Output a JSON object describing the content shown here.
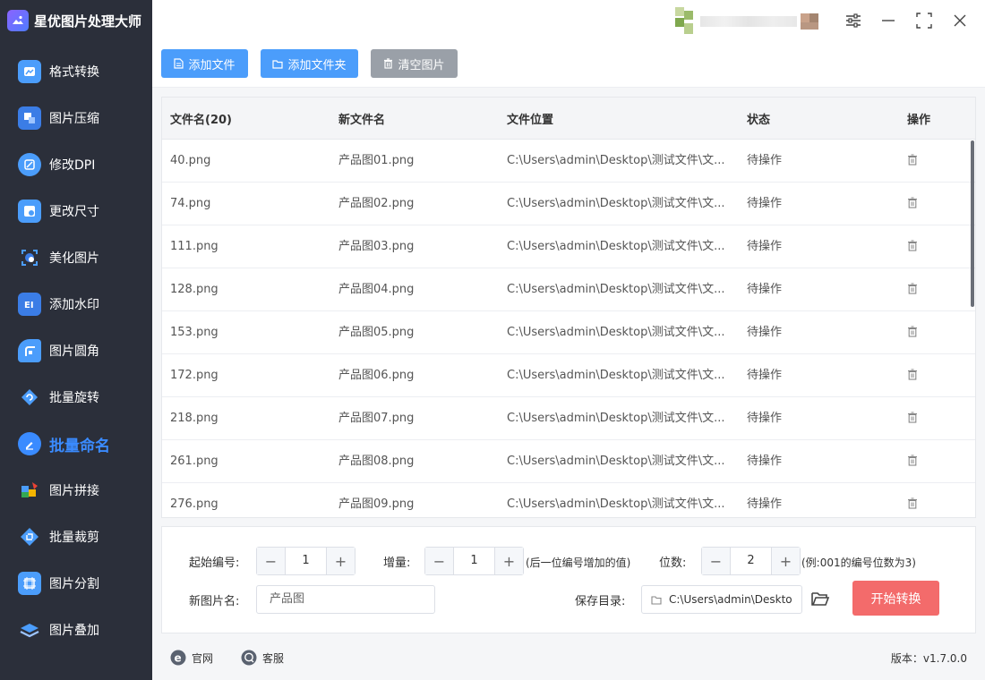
{
  "app": {
    "title": "星优图片处理大师"
  },
  "sidebar": {
    "items": [
      {
        "label": "格式转换",
        "icon": "image-convert-icon",
        "color": "#4b9dfb"
      },
      {
        "label": "图片压缩",
        "icon": "image-compress-icon",
        "color": "#4b9dfb"
      },
      {
        "label": "修改DPI",
        "icon": "dpi-icon",
        "color": "#4b9dfb"
      },
      {
        "label": "更改尺寸",
        "icon": "resize-icon",
        "color": "#4b9dfb"
      },
      {
        "label": "美化图片",
        "icon": "beautify-icon",
        "color": "#4b9dfb"
      },
      {
        "label": "添加水印",
        "icon": "watermark-icon",
        "color": "#4b9dfb"
      },
      {
        "label": "图片圆角",
        "icon": "round-corner-icon",
        "color": "#4b9dfb"
      },
      {
        "label": "批量旋转",
        "icon": "rotate-icon",
        "color": "#4b9dfb"
      },
      {
        "label": "批量命名",
        "icon": "rename-icon",
        "color": "#3a8bff",
        "active": true
      },
      {
        "label": "图片拼接",
        "icon": "stitch-icon",
        "color": "#4b9dfb"
      },
      {
        "label": "批量裁剪",
        "icon": "crop-icon",
        "color": "#4b9dfb"
      },
      {
        "label": "图片分割",
        "icon": "split-icon",
        "color": "#4b9dfb"
      },
      {
        "label": "图片叠加",
        "icon": "overlay-icon",
        "color": "#4b9dfb"
      }
    ]
  },
  "toolbar": {
    "add_file": "添加文件",
    "add_folder": "添加文件夹",
    "clear": "清空图片"
  },
  "table": {
    "headers": [
      "文件名(20)",
      "新文件名",
      "文件位置",
      "状态",
      "操作"
    ],
    "rows": [
      {
        "name": "40.png",
        "new_name": "产品图01.png",
        "path": "C:\\Users\\admin\\Desktop\\测试文件\\文...",
        "status": "待操作"
      },
      {
        "name": "74.png",
        "new_name": "产品图02.png",
        "path": "C:\\Users\\admin\\Desktop\\测试文件\\文...",
        "status": "待操作"
      },
      {
        "name": "111.png",
        "new_name": "产品图03.png",
        "path": "C:\\Users\\admin\\Desktop\\测试文件\\文...",
        "status": "待操作"
      },
      {
        "name": "128.png",
        "new_name": "产品图04.png",
        "path": "C:\\Users\\admin\\Desktop\\测试文件\\文...",
        "status": "待操作"
      },
      {
        "name": "153.png",
        "new_name": "产品图05.png",
        "path": "C:\\Users\\admin\\Desktop\\测试文件\\文...",
        "status": "待操作"
      },
      {
        "name": "172.png",
        "new_name": "产品图06.png",
        "path": "C:\\Users\\admin\\Desktop\\测试文件\\文...",
        "status": "待操作"
      },
      {
        "name": "218.png",
        "new_name": "产品图07.png",
        "path": "C:\\Users\\admin\\Desktop\\测试文件\\文...",
        "status": "待操作"
      },
      {
        "name": "261.png",
        "new_name": "产品图08.png",
        "path": "C:\\Users\\admin\\Desktop\\测试文件\\文...",
        "status": "待操作"
      },
      {
        "name": "276.png",
        "new_name": "产品图09.png",
        "path": "C:\\Users\\admin\\Desktop\\测试文件\\文...",
        "status": "待操作"
      }
    ]
  },
  "settings": {
    "start_label": "起始编号:",
    "start_value": "1",
    "increment_label": "增量:",
    "increment_value": "1",
    "increment_hint": "(后一位编号增加的值)",
    "digits_label": "位数:",
    "digits_value": "2",
    "digits_hint": "(例:001的编号位数为3)",
    "new_name_label": "新图片名:",
    "new_name_value": "产品图",
    "save_dir_label": "保存目录:",
    "save_dir_value": "C:\\Users\\admin\\Deskto",
    "start_button": "开始转换"
  },
  "footer": {
    "website": "官网",
    "support": "客服",
    "version": "版本：v1.7.0.0"
  },
  "colors": {
    "sidebar_bg": "#2b2f3a",
    "primary": "#4b9dfb",
    "danger": "#f36b6b",
    "active_nav": "#3a8bff"
  }
}
